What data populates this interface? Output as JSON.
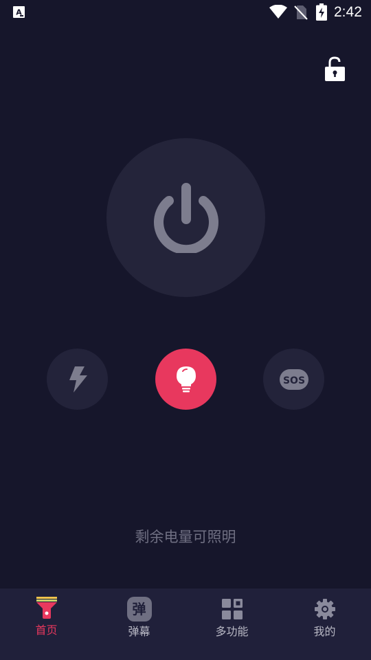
{
  "status_bar": {
    "time": "2:42",
    "left_icon": "a11y-notification-icon",
    "icons": [
      "wifi-icon",
      "no-sim-icon",
      "battery-charging-icon"
    ]
  },
  "lock": {
    "icon": "unlock-icon"
  },
  "power": {
    "icon": "power-icon"
  },
  "modes": [
    {
      "key": "flash",
      "icon": "lightning-icon"
    },
    {
      "key": "light",
      "icon": "light-bulb-icon",
      "active": true
    },
    {
      "key": "sos",
      "icon": "sos-icon"
    }
  ],
  "battery_hint": "剩余电量可照明",
  "bottom_nav": {
    "items": [
      {
        "label": "首页",
        "icon": "flashlight-icon",
        "active": true
      },
      {
        "label": "弹幕",
        "icon": "danmaku-icon",
        "icon_text": "弹"
      },
      {
        "label": "多功能",
        "icon": "grid-icon"
      },
      {
        "label": "我的",
        "icon": "settings-gear-icon"
      }
    ]
  },
  "colors": {
    "background": "#16162b",
    "accent": "#e8385e",
    "button_bg": "#24243a",
    "icon_gray": "#7d7d8e",
    "nav_bg": "#20203a"
  }
}
